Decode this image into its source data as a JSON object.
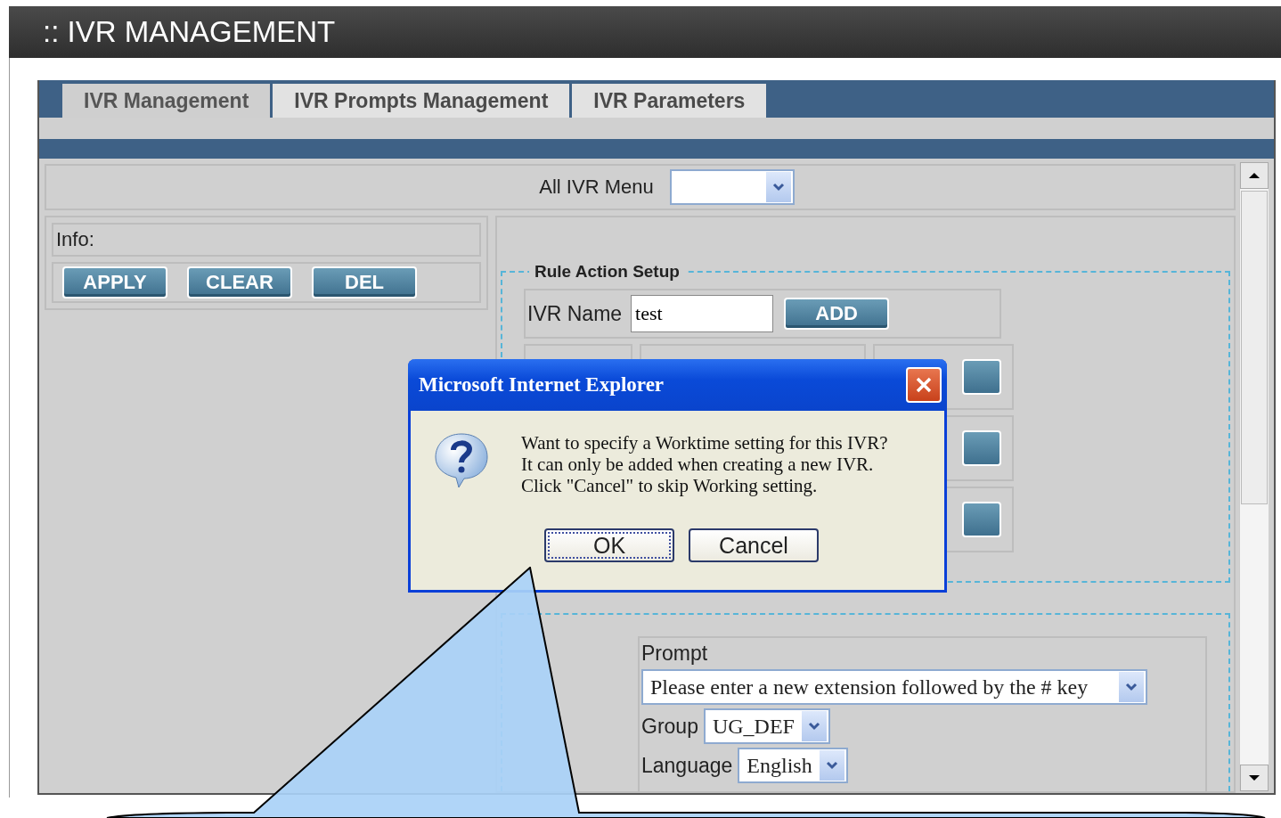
{
  "window": {
    "title": ":: IVR MANAGEMENT"
  },
  "tabs": [
    {
      "label": "IVR Management",
      "selected": true
    },
    {
      "label": "IVR Prompts Management",
      "selected": false
    },
    {
      "label": "IVR Parameters",
      "selected": false
    }
  ],
  "menu_selector": {
    "label": "All IVR Menu"
  },
  "info": {
    "label": "Info:"
  },
  "actions": [
    "APPLY",
    "CLEAR",
    "DEL"
  ],
  "rule_action_setup": {
    "legend": "Rule Action Setup",
    "ivr_name_label": "IVR Name",
    "ivr_name_value": "test",
    "add_button": "ADD"
  },
  "prompt_section": {
    "prompt_label": "Prompt",
    "prompt_value": "Please enter a new extension followed by the # key",
    "group_label": "Group",
    "group_value": "UG_DEF",
    "language_label": "Language",
    "language_value": "English"
  },
  "dialog": {
    "title": "Microsoft Internet Explorer",
    "message": [
      "Want to specify a Worktime setting for this IVR?",
      "It can only be added when creating a new IVR.",
      "Click \"Cancel\" to skip Working setting."
    ],
    "buttons": [
      {
        "label": "OK",
        "focused": true
      },
      {
        "label": "Cancel",
        "focused": false
      }
    ]
  }
}
